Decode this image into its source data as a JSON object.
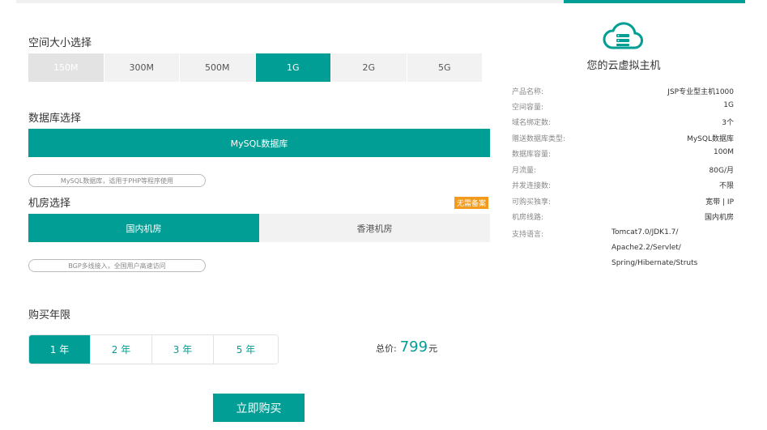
{
  "colors": {
    "accent": "#009e94",
    "badge": "#f19a1b"
  },
  "space": {
    "title": "空间大小选择",
    "options": [
      {
        "label": "150M",
        "state": "disabled"
      },
      {
        "label": "300M",
        "state": "normal"
      },
      {
        "label": "500M",
        "state": "normal"
      },
      {
        "label": "1G",
        "state": "selected"
      },
      {
        "label": "2G",
        "state": "normal"
      },
      {
        "label": "5G",
        "state": "normal"
      }
    ]
  },
  "database": {
    "title": "数据库选择",
    "option": "MySQL数据库",
    "note": "MySQL数据库，适用于PHP等程序使用"
  },
  "room": {
    "title": "机房选择",
    "badge": "无需备案",
    "options": [
      {
        "label": "国内机房",
        "state": "selected"
      },
      {
        "label": "香港机房",
        "state": "normal"
      }
    ],
    "note": "BGP多线接入，全国用户高速访问"
  },
  "years": {
    "title": "购买年限",
    "options": [
      {
        "label": "1 年",
        "state": "selected"
      },
      {
        "label": "2 年",
        "state": "normal"
      },
      {
        "label": "3 年",
        "state": "normal"
      },
      {
        "label": "5 年",
        "state": "normal"
      }
    ]
  },
  "total": {
    "label": "总价:",
    "price": "799",
    "unit": "元"
  },
  "buy_label": "立即购买",
  "summary": {
    "icon": "cloud-server-icon",
    "title": "您的云虚拟主机",
    "specs": [
      {
        "key": "产品名称:",
        "value": "JSP专业型主机1000"
      },
      {
        "key": "空间容量:",
        "value": "1G"
      },
      {
        "key": "域名绑定数:",
        "value": "3个"
      },
      {
        "key": "赠送数据库类型:",
        "value": "MySQL数据库"
      },
      {
        "key": "数据库容量:",
        "value": "100M"
      },
      {
        "key": "月流量:",
        "value": "80G/月"
      },
      {
        "key": "并发连接数:",
        "value": "不限"
      },
      {
        "key": "可购买独享:",
        "value": "宽带 | IP"
      },
      {
        "key": "机房线路:",
        "value": "国内机房"
      }
    ],
    "languages_label": "支持语言:",
    "languages": [
      "Tomcat7.0/JDK1.7/",
      "Apache2.2/Servlet/",
      "Spring/Hibernate/Struts"
    ]
  }
}
